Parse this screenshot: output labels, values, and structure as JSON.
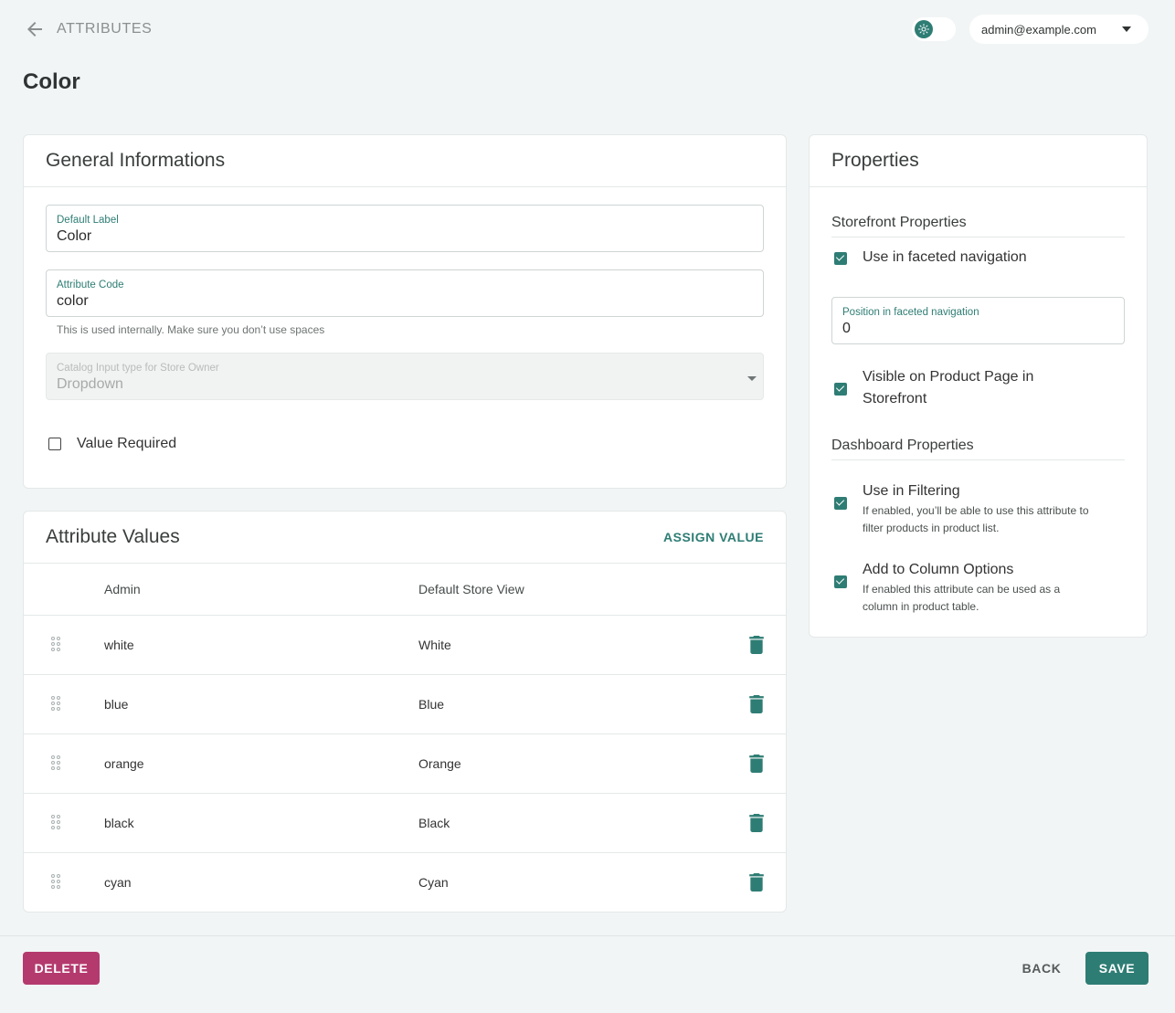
{
  "header": {
    "back_label": "ATTRIBUTES",
    "user_email": "admin@example.com"
  },
  "page": {
    "title": "Color"
  },
  "general": {
    "title": "General Informations",
    "default_label": {
      "label": "Default Label",
      "value": "Color"
    },
    "attribute_code": {
      "label": "Attribute Code",
      "value": "color",
      "helper": "This is used internally. Make sure you don’t use spaces"
    },
    "input_type": {
      "label": "Catalog Input type for Store Owner",
      "value": "Dropdown"
    },
    "value_required": {
      "label": "Value Required",
      "checked": false
    }
  },
  "values": {
    "title": "Attribute Values",
    "assign_label": "ASSIGN VALUE",
    "columns": {
      "admin": "Admin",
      "store": "Default Store View"
    },
    "rows": [
      {
        "admin": "white",
        "store": "White"
      },
      {
        "admin": "blue",
        "store": "Blue"
      },
      {
        "admin": "orange",
        "store": "Orange"
      },
      {
        "admin": "black",
        "store": "Black"
      },
      {
        "admin": "cyan",
        "store": "Cyan"
      }
    ]
  },
  "properties": {
    "title": "Properties",
    "storefront_title": "Storefront Properties",
    "faceted": {
      "label": "Use in faceted navigation",
      "checked": true
    },
    "position": {
      "label": "Position in faceted navigation",
      "value": "0"
    },
    "visible": {
      "label_line1": "Visible on Product Page in",
      "label_line2": "Storefront",
      "checked": true
    },
    "dashboard_title": "Dashboard Properties",
    "filtering": {
      "label": "Use in Filtering",
      "help_line1": "If enabled, you’ll be able to use this attribute to",
      "help_line2": "filter products in product list.",
      "checked": true
    },
    "column": {
      "label": "Add to Column Options",
      "help_line1": "If enabled this attribute can be used as a",
      "help_line2": "column in product table.",
      "checked": true
    }
  },
  "footer": {
    "delete": "DELETE",
    "back": "BACK",
    "save": "SAVE"
  },
  "colors": {
    "accent": "#2e7d74",
    "danger": "#b43a6e",
    "background": "#f2f5f5"
  },
  "icons": {
    "back": "arrow-left-icon",
    "theme": "sun-icon",
    "menu": "chevron-down-icon",
    "drag": "drag-handle-icon",
    "delete": "trash-icon"
  }
}
